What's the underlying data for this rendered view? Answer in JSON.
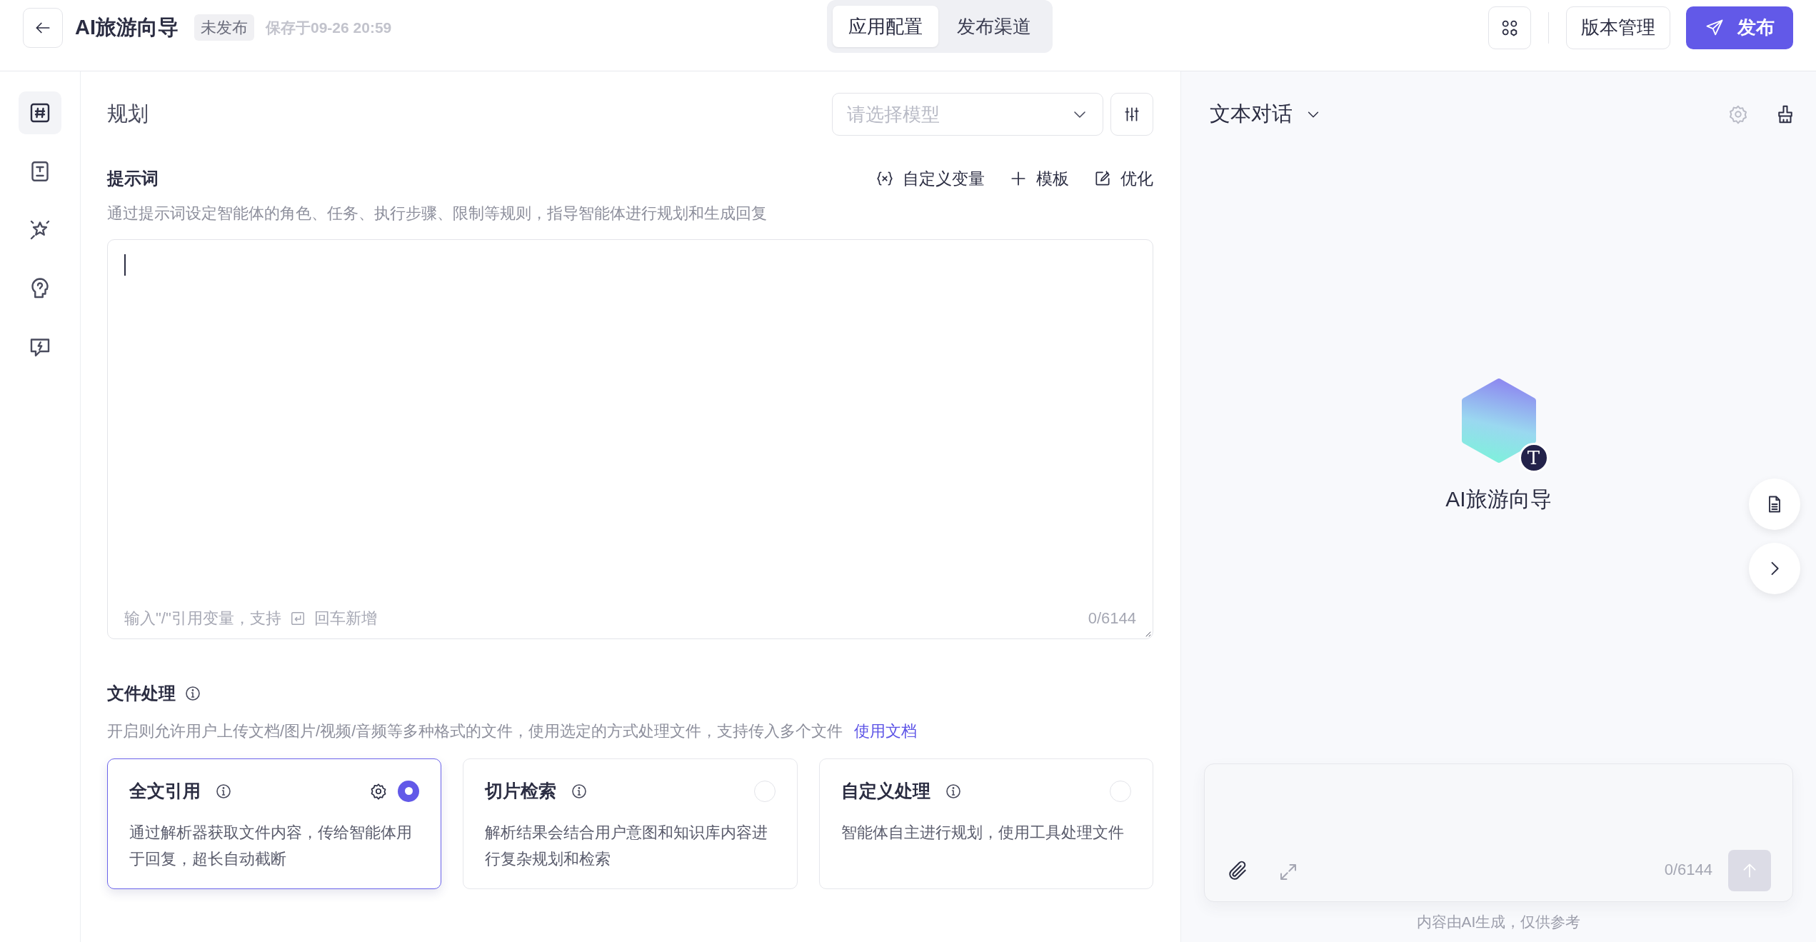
{
  "header": {
    "title": "AI旅游向导",
    "status_badge": "未发布",
    "saved_time": "保存于09-26 20:59"
  },
  "tabs": [
    {
      "label": "应用配置",
      "selected": true
    },
    {
      "label": "发布渠道",
      "selected": false
    }
  ],
  "actions": {
    "version_button": "版本管理",
    "publish_button": "发布"
  },
  "sidebar": {
    "items": [
      {
        "selected": true
      },
      {
        "selected": false
      },
      {
        "selected": false
      },
      {
        "selected": false
      },
      {
        "selected": false
      }
    ]
  },
  "config": {
    "section_title": "规划",
    "model_select": {
      "placeholder": "请选择模型"
    },
    "prompt": {
      "label": "提示词",
      "tools": [
        "自定义变量",
        "模板",
        "优化"
      ],
      "description": "通过提示词设定智能体的角色、任务、执行步骤、限制等规则，指导智能体进行规划和生成回复",
      "hint_before": "输入\"/\"引用变量，支持",
      "hint_after": "回车新增",
      "counter": "0/6144"
    },
    "file_processing": {
      "label": "文件处理",
      "description": "开启则允许用户上传文档/图片/视频/音频等多种格式的文件，使用选定的方式处理文件，支持传入多个文件",
      "doc_link": "使用文档",
      "options": [
        {
          "title": "全文引用",
          "description": "通过解析器获取文件内容，传给智能体用于回复，超长自动截断",
          "selected": true
        },
        {
          "title": "切片检索",
          "description": "解析结果会结合用户意图和知识库内容进行复杂规划和检索",
          "selected": false
        },
        {
          "title": "自定义处理",
          "description": "智能体自主进行规划，使用工具处理文件",
          "selected": false
        }
      ]
    }
  },
  "preview": {
    "mode": "文本对话",
    "agent_name": "AI旅游向导",
    "avatar_badge": "T",
    "input_counter": "0/6144",
    "disclaimer": "内容由AI生成，仅供参考"
  }
}
